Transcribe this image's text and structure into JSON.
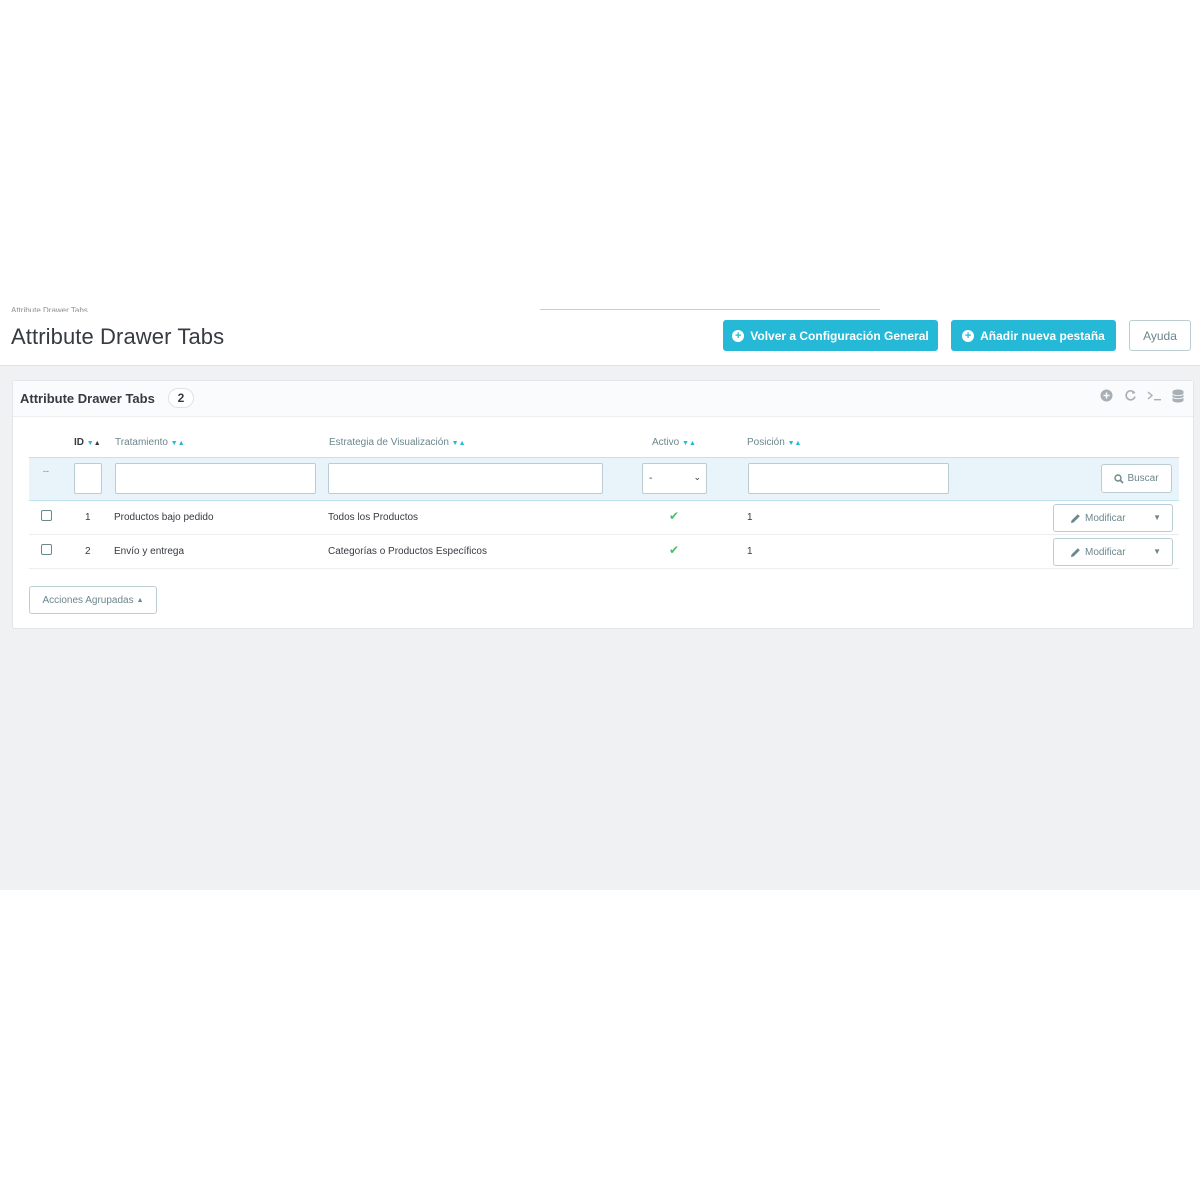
{
  "header": {
    "breadcrumb": "Attribute Drawer Tabs",
    "title": "Attribute Drawer Tabs",
    "back_button": "Volver a Configuración General",
    "add_button": "Añadir nueva pestaña",
    "help_button": "Ayuda"
  },
  "panel": {
    "title": "Attribute Drawer Tabs",
    "count": "2"
  },
  "table": {
    "columns": {
      "id": "ID",
      "treatment": "Tratamiento",
      "strategy": "Estrategia de Visualización",
      "active": "Activo",
      "position": "Posición"
    },
    "filter": {
      "dash": "--",
      "active_select": "-",
      "search_button": "Buscar"
    },
    "rows": [
      {
        "id": "1",
        "treatment": "Productos bajo pedido",
        "strategy": "Todos los Productos",
        "active": true,
        "position": "1",
        "action": "Modificar"
      },
      {
        "id": "2",
        "treatment": "Envío y entrega",
        "strategy": "Categorías o Productos Específicos",
        "active": true,
        "position": "1",
        "action": "Modificar"
      }
    ]
  },
  "bulk_actions": "Acciones Agrupadas",
  "colors": {
    "accent": "#25b9d7",
    "success": "#4cbb6c",
    "background": "#eff1f2"
  },
  "icons": [
    "plus-circle-icon",
    "refresh-icon",
    "terminal-icon",
    "database-icon",
    "search-icon",
    "pencil-icon",
    "caret-down-icon",
    "check-icon"
  ]
}
